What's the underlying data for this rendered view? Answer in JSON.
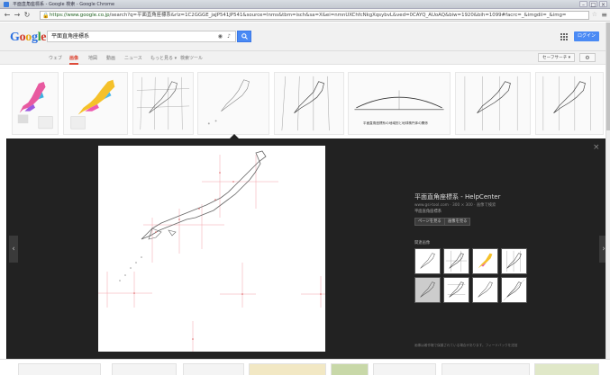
{
  "window": {
    "title": "平面直角座標系 - Google 検索 - Google Chrome"
  },
  "addressbar": {
    "url_host": "https://www.google.co.jp",
    "url_path": "/search?q=平面直角座標系&rlz=1C2GGGE_jaJP541JP541&source=lnms&tbm=isch&sa=X&ei=nmnUXChfcNkgXqsybvL&ved=0CAYQ_AUoAQ&biw=1920&bih=1099#facrc=_&imgdii=_&img="
  },
  "search": {
    "query": "平面直角座標系",
    "signin_label": "ログイン"
  },
  "tabs": [
    {
      "label": "ウェブ"
    },
    {
      "label": "画像"
    },
    {
      "label": "地図"
    },
    {
      "label": "動画"
    },
    {
      "label": "ニュース"
    },
    {
      "label": "もっと見る ▾"
    },
    {
      "label": "検索ツール"
    }
  ],
  "safesearch_label": "セーフサーチ ▾",
  "preview": {
    "title": "平面直角座標系 - HelpCenter",
    "site": "www.gsi-tool.com · 300 × 300 · 画像で検索",
    "description": "平面直角座標系",
    "buttons": [
      "ページを見る",
      "画像を見る"
    ],
    "related_label": "関連画像",
    "thumb_caption": "平面直角座標系の地域別と地球楕円体の関係",
    "footer": "画像は著作権で保護されている場合があります。フィードバックを送信"
  },
  "colors": {
    "accent_red": "#dd4b39",
    "google_blue": "#4a8af4",
    "panel_bg": "#222222"
  },
  "icons": [
    "lock-icon",
    "camera-icon",
    "mic-icon",
    "search-icon",
    "apps-icon",
    "gear-icon",
    "close-icon",
    "chevron-left-icon",
    "chevron-right-icon",
    "star-icon",
    "menu-icon"
  ]
}
